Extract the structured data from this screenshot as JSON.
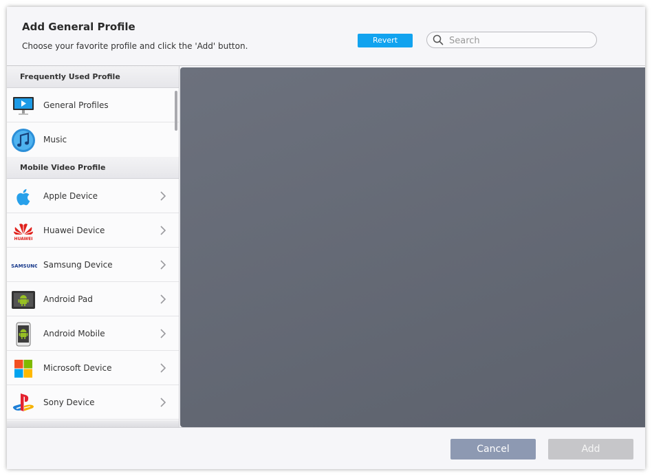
{
  "header": {
    "title": "Add General Profile",
    "subtitle": "Choose your favorite profile and click the 'Add' button.",
    "revert_label": "Revert",
    "search_placeholder": "Search"
  },
  "sidebar": {
    "sections": [
      {
        "title": "Frequently Used Profile",
        "items": [
          {
            "label": "General Profiles",
            "icon": "monitor-icon",
            "chevron": false
          },
          {
            "label": "Music",
            "icon": "music-note-icon",
            "chevron": false
          }
        ]
      },
      {
        "title": "Mobile Video Profile",
        "items": [
          {
            "label": "Apple Device",
            "icon": "apple-logo-icon",
            "chevron": true
          },
          {
            "label": "Huawei Device",
            "icon": "huawei-logo-icon",
            "chevron": true
          },
          {
            "label": "Samsung Device",
            "icon": "samsung-logo-icon",
            "chevron": true
          },
          {
            "label": "Android Pad",
            "icon": "android-tablet-icon",
            "chevron": true
          },
          {
            "label": "Android Mobile",
            "icon": "android-phone-icon",
            "chevron": true
          },
          {
            "label": "Microsoft Device",
            "icon": "microsoft-logo-icon",
            "chevron": true
          },
          {
            "label": "Sony Device",
            "icon": "playstation-logo-icon",
            "chevron": true
          }
        ]
      }
    ],
    "samsung_logo_text": "SAMSUNG",
    "huawei_logo_text": "HUAWEI"
  },
  "footer": {
    "cancel_label": "Cancel",
    "add_label": "Add"
  },
  "colors": {
    "accent": "#12a3ef",
    "cancel": "#8d99b2",
    "add_disabled": "#c6c6c9",
    "preview_bg": "#626773"
  }
}
